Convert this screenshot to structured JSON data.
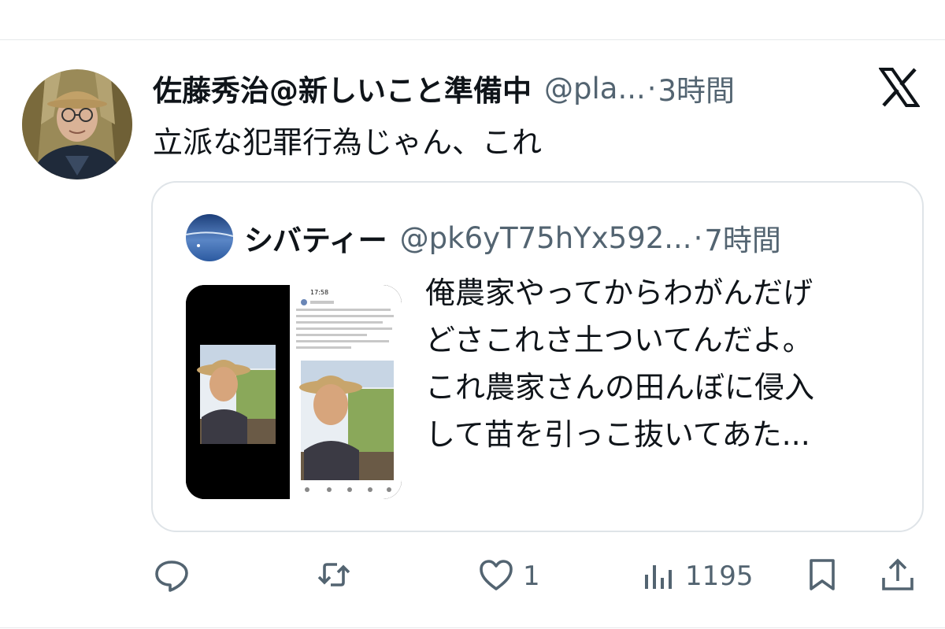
{
  "tweet": {
    "author_name": "佐藤秀治@新しいこと準備中",
    "author_handle": "@pla...",
    "separator": "·",
    "time": "3時間",
    "text": "立派な犯罪行為じゃん、これ"
  },
  "quote": {
    "author_name": "シバティー",
    "author_handle": "@pk6yT75hYx592...",
    "separator": "·",
    "time": "7時間",
    "text_lines": [
      "俺農家やってからわがんだげ",
      "どさこれさ土ついてんだよ。",
      "これ農家さんの田んぼに侵入",
      "して苗を引っこ抜いてあた..."
    ],
    "thumbnail": {
      "phone_time": "17:58"
    }
  },
  "actions": {
    "reply_icon": "speech-bubble-icon",
    "retweet_icon": "retweet-icon",
    "like_icon": "heart-icon",
    "like_count": "1",
    "views_icon": "bar-chart-icon",
    "views_count": "1195",
    "bookmark_icon": "bookmark-icon",
    "share_icon": "share-upload-icon"
  },
  "brand_logo": "x-logo",
  "colors": {
    "text_primary": "#0f1419",
    "text_secondary": "#536471",
    "border": "#dfe4e8"
  }
}
